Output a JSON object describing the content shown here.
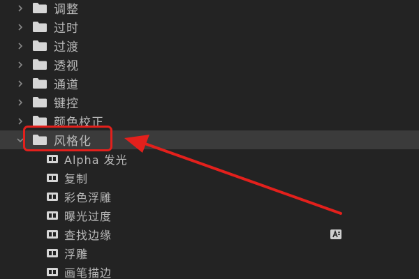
{
  "colors": {
    "background": "#232323",
    "selected_row": "#3b3b3b",
    "text": "#b9b9b9",
    "annotation": "#e3201c"
  },
  "tree": {
    "folders": [
      {
        "label": "调整",
        "icon": "folder-icon",
        "expanded": false
      },
      {
        "label": "过时",
        "icon": "folder-icon",
        "expanded": false
      },
      {
        "label": "过渡",
        "icon": "folder-icon",
        "expanded": false
      },
      {
        "label": "透视",
        "icon": "folder-icon",
        "expanded": false
      },
      {
        "label": "通道",
        "icon": "folder-icon",
        "expanded": false
      },
      {
        "label": "键控",
        "icon": "folder-icon",
        "expanded": false
      },
      {
        "label": "颜色校正",
        "icon": "folder-icon",
        "expanded": false
      },
      {
        "label": "风格化",
        "icon": "folder-icon",
        "expanded": true,
        "selected": true
      }
    ],
    "effects": [
      {
        "label": "Alpha 发光",
        "icon": "effect-icon"
      },
      {
        "label": "复制",
        "icon": "effect-icon"
      },
      {
        "label": "彩色浮雕",
        "icon": "effect-icon"
      },
      {
        "label": "曝光过度",
        "icon": "effect-icon"
      },
      {
        "label": "查找边缘",
        "icon": "effect-icon",
        "badge": "accelerated-effect-icon"
      },
      {
        "label": "浮雕",
        "icon": "effect-icon"
      },
      {
        "label": "画笔描边",
        "icon": "effect-icon"
      }
    ]
  }
}
